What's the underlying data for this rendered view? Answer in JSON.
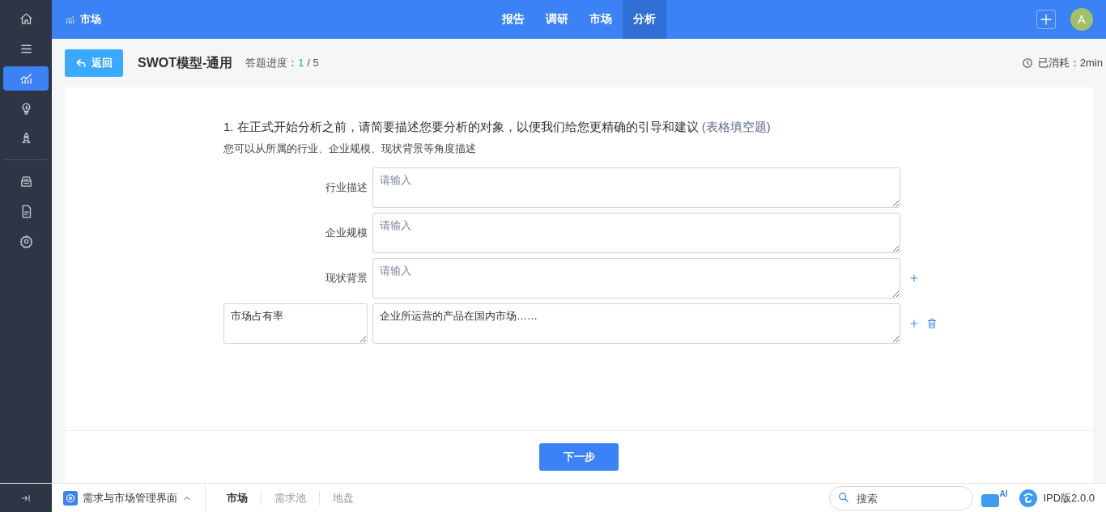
{
  "sidebar": {
    "groups": [
      [
        {
          "selected": false
        },
        {
          "selected": false
        },
        {
          "selected": true
        },
        {
          "selected": false
        },
        {
          "selected": false
        }
      ],
      [
        {
          "selected": false
        },
        {
          "selected": false
        },
        {
          "selected": false
        }
      ]
    ]
  },
  "top_bar": {
    "title": "市场",
    "nav": [
      {
        "label": "报告",
        "selected": false
      },
      {
        "label": "调研",
        "selected": false
      },
      {
        "label": "市场",
        "selected": false
      },
      {
        "label": "分析",
        "selected": true
      }
    ],
    "avatar": "A"
  },
  "header": {
    "back": "返回",
    "title": "SWOT模型-通用",
    "progress_label": "答题进度：",
    "progress_current": "1",
    "progress_total": "/ 5",
    "elapsed": "已消耗：2min"
  },
  "question": {
    "title": "1. 在正式开始分析之前，请简要描述您要分析的对象，以便我们给您更精确的引导和建议",
    "type": "(表格填空题)",
    "hint": "您可以从所属的行业、企业规模、现状背景等角度描述",
    "rows": [
      {
        "kind": "fixed",
        "label": "行业描述",
        "placeholder": "请输入",
        "can_add": false,
        "can_delete": false
      },
      {
        "kind": "fixed",
        "label": "企业规模",
        "placeholder": "请输入",
        "can_add": false,
        "can_delete": false
      },
      {
        "kind": "fixed",
        "label": "现状背景",
        "placeholder": "请输入",
        "can_add": true,
        "can_delete": false
      },
      {
        "kind": "custom",
        "label": "市场占有率",
        "value": "企业所运营的产品在国内市场……",
        "can_add": true,
        "can_delete": true
      }
    ]
  },
  "next_button": "下一步",
  "bottom_bar": {
    "app": "需求与市场管理界面",
    "tabs": [
      {
        "label": "市场",
        "selected": true
      },
      {
        "label": "需求池",
        "selected": false
      },
      {
        "label": "地盘",
        "selected": false
      }
    ],
    "search_placeholder": "搜索",
    "ai": "AI",
    "version": "IPD版2.0.0"
  }
}
